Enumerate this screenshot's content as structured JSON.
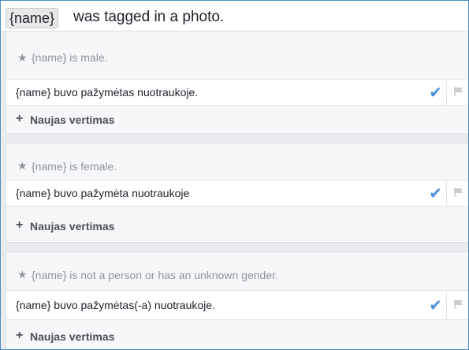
{
  "header": {
    "token": "{name}",
    "title": "was tagged in a photo."
  },
  "cards": [
    {
      "condition": "{name} is male.",
      "translation": "{name} buvo pažymėtas nuotraukoje.",
      "new_translation": "Naujas vertimas"
    },
    {
      "condition": "{name} is female.",
      "translation": "{name} buvo pažymėta nuotraukoje",
      "new_translation": "Naujas vertimas"
    },
    {
      "condition": "{name} is not a person or has an unknown gender.",
      "translation": "{name} buvo pažymėtas(-a) nuotraukoje.",
      "new_translation": "Naujas vertimas"
    }
  ],
  "icons": {
    "star": "star-icon",
    "check": "checkmark-icon",
    "flag": "flag-icon",
    "plus": "plus-icon"
  },
  "colors": {
    "accent_check": "#4a90d9",
    "muted_text": "#8d949e",
    "frame_border": "#4a8fc4"
  }
}
